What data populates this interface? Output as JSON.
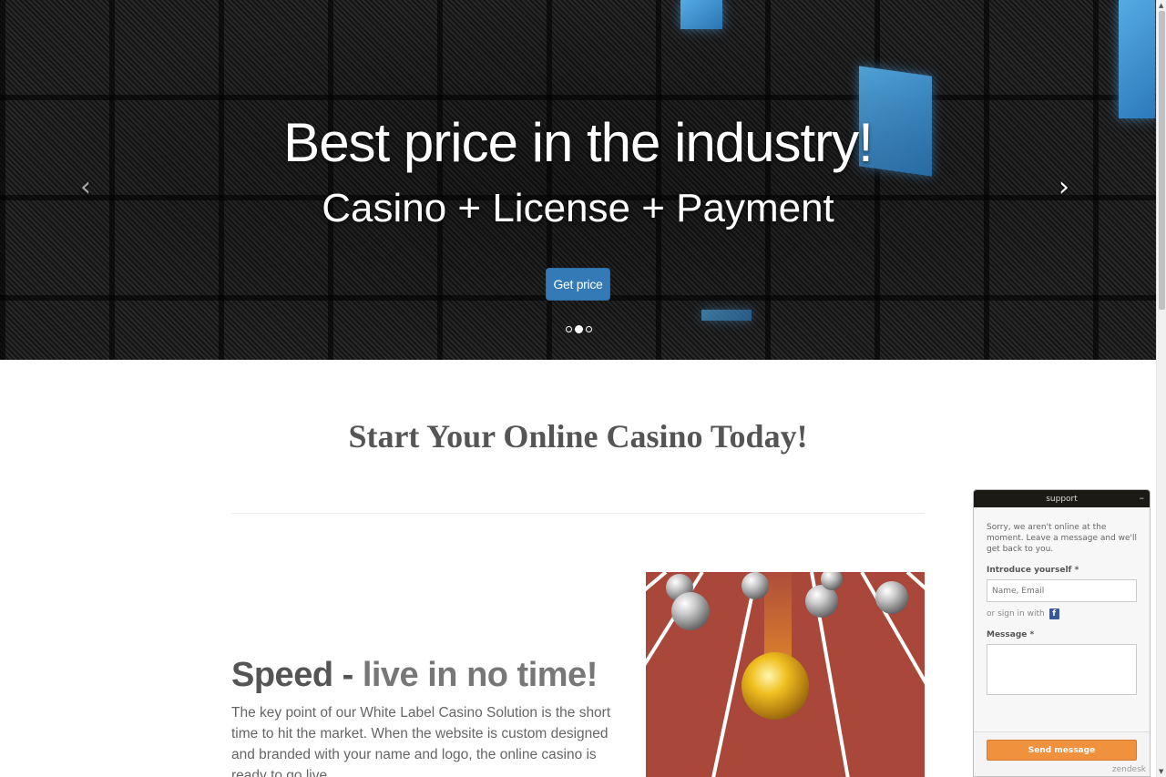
{
  "hero": {
    "title": "Best price in the industry!",
    "subtitle": "Casino + License + Payment",
    "cta_label": "Get price",
    "prev_icon": "‹",
    "next_icon": "›",
    "slides_count": 3,
    "active_slide": 2
  },
  "main": {
    "section_title": "Start Your Online Casino Today!",
    "feature": {
      "title_main": "Speed - ",
      "title_accent": "live in no time!",
      "text": "The key point of our White Label Casino Solution is the short time to hit the market. When the website is custom designed and branded with your name and logo, the online casino is ready to go live."
    }
  },
  "support_widget": {
    "header": "support",
    "minimize_icon": "–",
    "offline_message": "Sorry, we aren't online at the moment. Leave a message and we'll get back to you.",
    "intro_label": "Introduce yourself *",
    "intro_placeholder": "Name, Email",
    "signin_text": "or sign in with",
    "facebook_icon": "f",
    "message_label": "Message *",
    "send_label": "Send message",
    "brand": "zendesk"
  },
  "colors": {
    "primary_button": "#337ab7",
    "send_button": "#f0913e",
    "widget_header": "#1b1a14",
    "heading_text": "#555555"
  }
}
